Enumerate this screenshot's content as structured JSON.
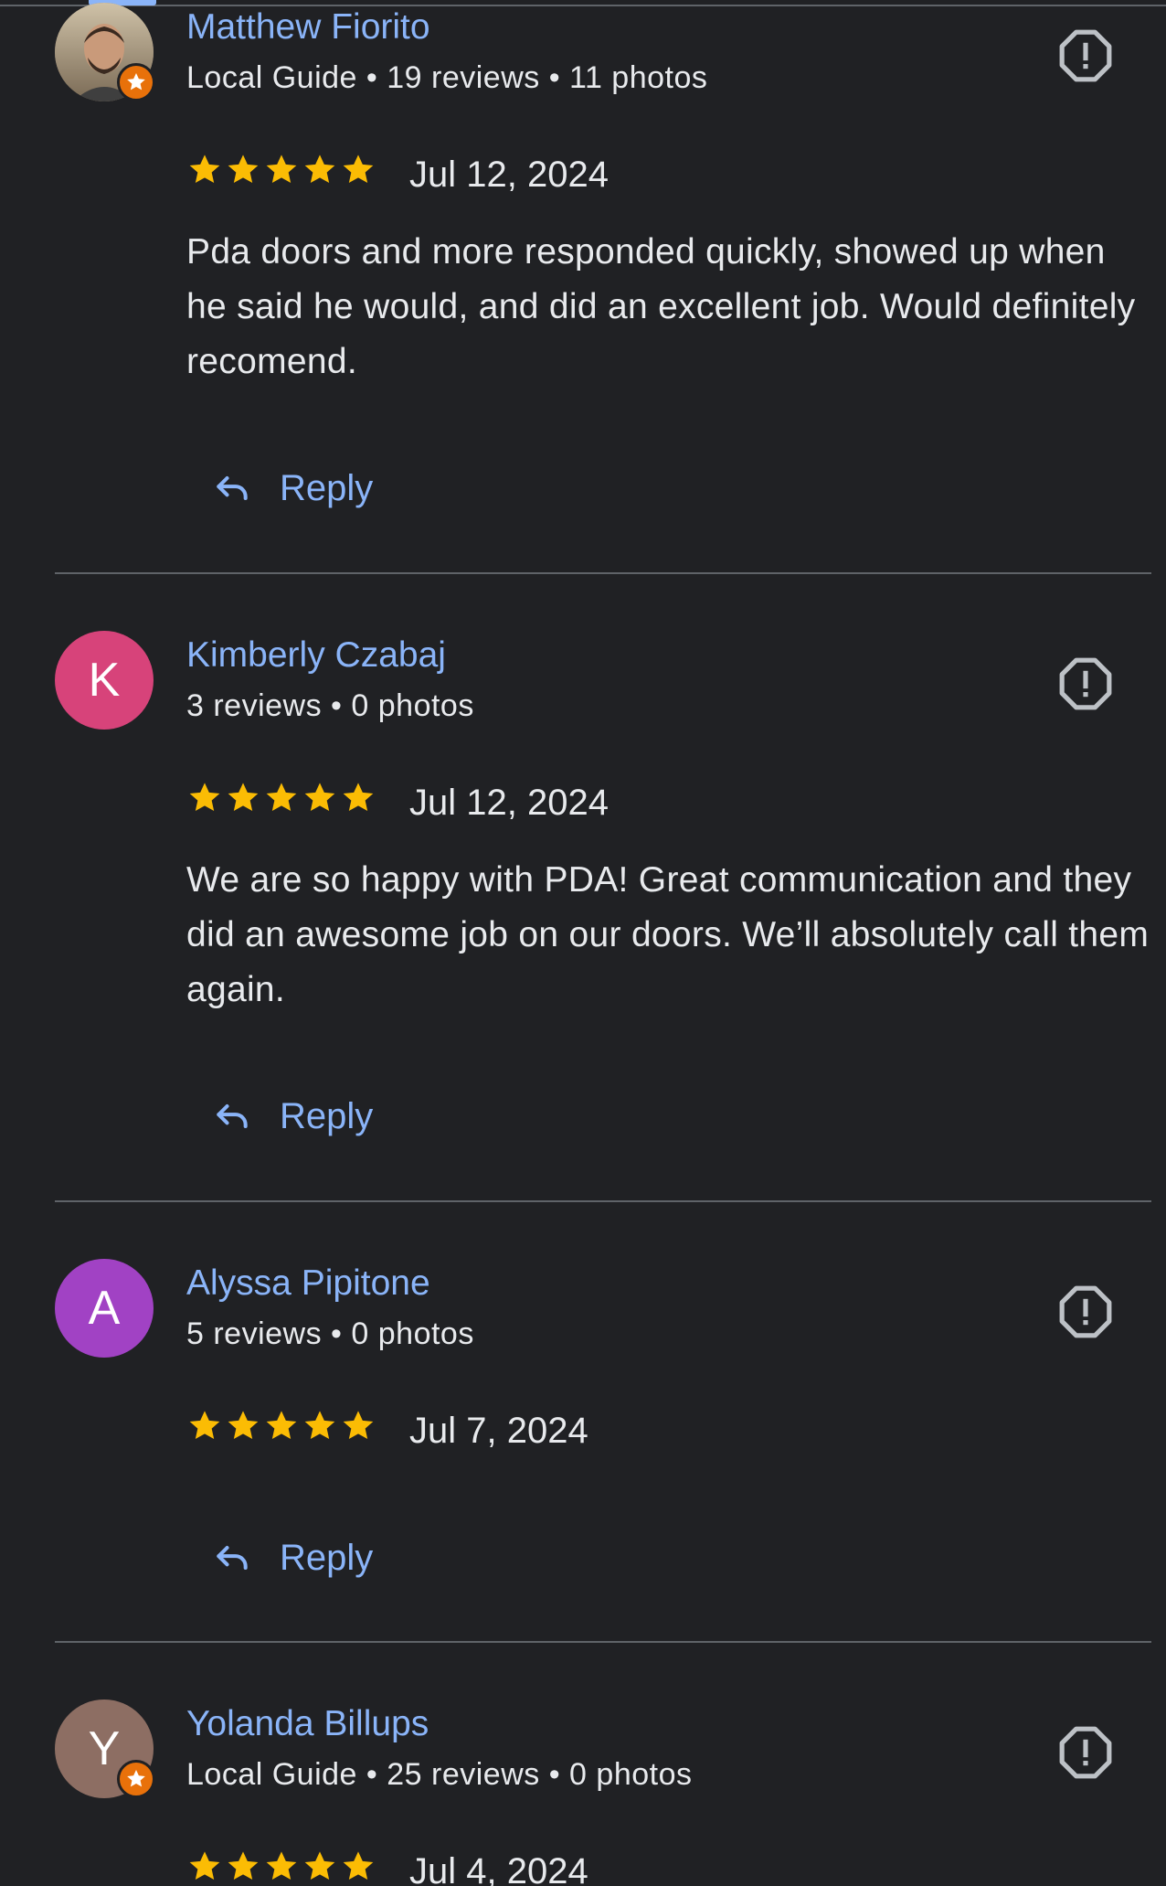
{
  "reviews": [
    {
      "name": "Matthew Fiorito",
      "meta": "Local Guide • 19 reviews • 11 photos",
      "avatar_type": "photo",
      "avatar_initial": "",
      "avatar_color": "#8d7a64",
      "local_guide": true,
      "rating": 5,
      "date": "Jul 12, 2024",
      "text": "Pda doors and more responded quickly, showed up when he said he would, and did an excellent job. Would definitely recomend.",
      "reply_label": "Reply"
    },
    {
      "name": "Kimberly Czabaj",
      "meta": "3 reviews • 0 photos",
      "avatar_type": "initial",
      "avatar_initial": "K",
      "avatar_color": "#d7437a",
      "local_guide": false,
      "rating": 5,
      "date": "Jul 12, 2024",
      "text": "We are so happy with PDA! Great communication and they did an awesome job on our doors. We’ll absolutely call them again.",
      "reply_label": "Reply"
    },
    {
      "name": "Alyssa Pipitone",
      "meta": "5 reviews • 0 photos",
      "avatar_type": "initial",
      "avatar_initial": "A",
      "avatar_color": "#a142c4",
      "local_guide": false,
      "rating": 5,
      "date": "Jul 7, 2024",
      "text": "",
      "reply_label": "Reply"
    },
    {
      "name": "Yolanda Billups",
      "meta": "Local Guide • 25 reviews • 0 photos",
      "avatar_type": "initial",
      "avatar_initial": "Y",
      "avatar_color": "#8d6e63",
      "local_guide": true,
      "rating": 5,
      "date": "Jul 4, 2024",
      "text": "",
      "reply_label": ""
    }
  ],
  "colors": {
    "background": "#202124",
    "link_blue": "#8ab4f8",
    "star_yellow": "#fbbc04",
    "divider": "#5f6368",
    "local_guide_badge": "#e8710a"
  },
  "icons": {
    "report": "report-flag-icon",
    "reply": "reply-arrow-icon",
    "star": "star-icon",
    "local_guide": "local-guide-badge-icon"
  }
}
